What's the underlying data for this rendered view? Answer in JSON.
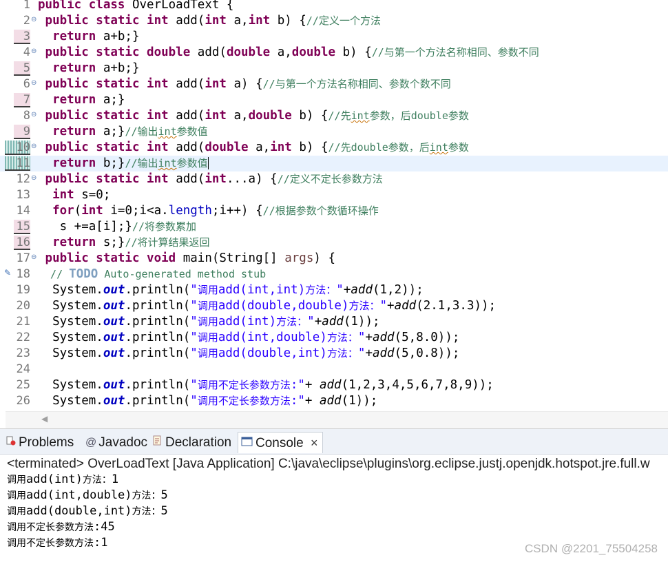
{
  "editor": {
    "lines": [
      {
        "num": "1",
        "segs": [
          [
            "kw",
            "public class "
          ],
          [
            "",
            "OverLoadText {"
          ]
        ]
      },
      {
        "num": "2",
        "segs": [
          [
            "kw",
            " public static int "
          ],
          [
            "",
            "add("
          ],
          [
            "kw",
            "int "
          ],
          [
            "",
            "a,"
          ],
          [
            "kw",
            "int "
          ],
          [
            "",
            "b) {"
          ],
          [
            "cm",
            "//定义一个方法"
          ]
        ]
      },
      {
        "num": "3",
        "segs": [
          [
            "kw",
            "  return "
          ],
          [
            "",
            "a+b;}"
          ]
        ]
      },
      {
        "num": "4",
        "segs": [
          [
            "kw",
            " public static double "
          ],
          [
            "",
            "add("
          ],
          [
            "kw",
            "double "
          ],
          [
            "",
            "a,"
          ],
          [
            "kw",
            "double "
          ],
          [
            "",
            "b) {"
          ],
          [
            "cm",
            "//与第一个方法名称相同、参数不同"
          ]
        ]
      },
      {
        "num": "5",
        "segs": [
          [
            "kw",
            "  return "
          ],
          [
            "",
            "a+b;}"
          ]
        ]
      },
      {
        "num": "6",
        "segs": [
          [
            "kw",
            " public static int "
          ],
          [
            "",
            "add("
          ],
          [
            "kw",
            "int "
          ],
          [
            "",
            "a) {"
          ],
          [
            "cm",
            "//与第一个方法名称相同、参数个数不同"
          ]
        ]
      },
      {
        "num": "7",
        "segs": [
          [
            "kw",
            "  return "
          ],
          [
            "",
            "a;}"
          ]
        ]
      },
      {
        "num": "8",
        "segs": [
          [
            "kw",
            " public static int "
          ],
          [
            "",
            "add("
          ],
          [
            "kw",
            "int "
          ],
          [
            "",
            "a,"
          ],
          [
            "kw",
            "double "
          ],
          [
            "",
            "b) {"
          ],
          [
            "cm",
            "//先"
          ],
          [
            "cm squig",
            "int"
          ],
          [
            "cm",
            "参数，后double参数"
          ]
        ]
      },
      {
        "num": "9",
        "segs": [
          [
            "kw",
            "  return "
          ],
          [
            "",
            "a;}"
          ],
          [
            "cm",
            "//输出"
          ],
          [
            "cm squig",
            "int"
          ],
          [
            "cm",
            "参数值"
          ]
        ]
      },
      {
        "num": "10",
        "segs": [
          [
            "kw",
            " public static int "
          ],
          [
            "",
            "add("
          ],
          [
            "kw",
            "double "
          ],
          [
            "",
            "a,"
          ],
          [
            "kw",
            "int "
          ],
          [
            "",
            "b) {"
          ],
          [
            "cm",
            "//先double参数，后"
          ],
          [
            "cm squig",
            "int"
          ],
          [
            "cm",
            "参数"
          ]
        ]
      },
      {
        "num": "11",
        "segs": [
          [
            "kw",
            "  return "
          ],
          [
            "",
            "b;}"
          ],
          [
            "cm",
            "//输出"
          ],
          [
            "cm squig",
            "int"
          ],
          [
            "cm",
            "参数值"
          ]
        ]
      },
      {
        "num": "12",
        "segs": [
          [
            "kw",
            " public static int "
          ],
          [
            "",
            "add("
          ],
          [
            "kw",
            "int"
          ],
          [
            "",
            "...a) {"
          ],
          [
            "cm",
            "//定义不定长参数方法"
          ]
        ]
      },
      {
        "num": "13",
        "segs": [
          [
            "kw",
            "  int "
          ],
          [
            "",
            "s=0;"
          ]
        ]
      },
      {
        "num": "14",
        "segs": [
          [
            "kw",
            "  for"
          ],
          [
            "",
            "("
          ],
          [
            "kw",
            "int "
          ],
          [
            "",
            "i=0;i<a."
          ],
          [
            "fd",
            "length"
          ],
          [
            "",
            ";i++) {"
          ],
          [
            "cm",
            "//根据参数个数循环操作"
          ]
        ]
      },
      {
        "num": "15",
        "segs": [
          [
            "",
            "   s +=a[i];}"
          ],
          [
            "cm",
            "//将参数累加"
          ]
        ]
      },
      {
        "num": "16",
        "segs": [
          [
            "kw",
            "  return "
          ],
          [
            "",
            "s;}"
          ],
          [
            "cm",
            "//将计算结果返回"
          ]
        ]
      },
      {
        "num": "17",
        "segs": [
          [
            "kw",
            " public static void "
          ],
          [
            "",
            "main(String[] "
          ],
          [
            "param",
            "args"
          ],
          [
            "",
            ") {"
          ]
        ]
      },
      {
        "num": "18",
        "segs": [
          [
            "cm",
            "  // "
          ],
          [
            "cmk",
            "TODO"
          ],
          [
            "cm",
            " Auto-generated method stub"
          ]
        ]
      },
      {
        "num": "19",
        "segs": [
          [
            "",
            "  System."
          ],
          [
            "fl",
            "out"
          ],
          [
            "",
            ".println("
          ],
          [
            "st",
            "\"调用add(int,int)方法：\""
          ],
          [
            "",
            "+"
          ],
          [
            "sm",
            "add"
          ],
          [
            "",
            "(1,2));"
          ]
        ]
      },
      {
        "num": "20",
        "segs": [
          [
            "",
            "  System."
          ],
          [
            "fl",
            "out"
          ],
          [
            "",
            ".println("
          ],
          [
            "st",
            "\"调用add(double,double)方法：\""
          ],
          [
            "",
            "+"
          ],
          [
            "sm",
            "add"
          ],
          [
            "",
            "(2.1,3.3));"
          ]
        ]
      },
      {
        "num": "21",
        "segs": [
          [
            "",
            "  System."
          ],
          [
            "fl",
            "out"
          ],
          [
            "",
            ".println("
          ],
          [
            "st",
            "\"调用add(int)方法：\""
          ],
          [
            "",
            "+"
          ],
          [
            "sm",
            "add"
          ],
          [
            "",
            "(1));"
          ]
        ]
      },
      {
        "num": "22",
        "segs": [
          [
            "",
            "  System."
          ],
          [
            "fl",
            "out"
          ],
          [
            "",
            ".println("
          ],
          [
            "st",
            "\"调用add(int,double)方法：\""
          ],
          [
            "",
            "+"
          ],
          [
            "sm",
            "add"
          ],
          [
            "",
            "(5,8.0));"
          ]
        ]
      },
      {
        "num": "23",
        "segs": [
          [
            "",
            "  System."
          ],
          [
            "fl",
            "out"
          ],
          [
            "",
            ".println("
          ],
          [
            "st",
            "\"调用add(double,int)方法：\""
          ],
          [
            "",
            "+"
          ],
          [
            "sm",
            "add"
          ],
          [
            "",
            "(5,0.8));"
          ]
        ]
      },
      {
        "num": "24",
        "segs": []
      },
      {
        "num": "25",
        "segs": [
          [
            "",
            "  System."
          ],
          [
            "fl",
            "out"
          ],
          [
            "",
            ".println("
          ],
          [
            "st",
            "\"调用不定长参数方法:\""
          ],
          [
            "",
            "+ "
          ],
          [
            "sm",
            "add"
          ],
          [
            "",
            "(1,2,3,4,5,6,7,8,9));"
          ]
        ]
      },
      {
        "num": "26",
        "segs": [
          [
            "",
            "  System."
          ],
          [
            "fl",
            "out"
          ],
          [
            "",
            ".println("
          ],
          [
            "st",
            "\"调用不定长参数方法:\""
          ],
          [
            "",
            "+ "
          ],
          [
            "sm",
            "add"
          ],
          [
            "",
            "(1));"
          ]
        ]
      }
    ],
    "marked_lines": [
      "3",
      "5",
      "7",
      "9",
      "15",
      "16"
    ],
    "changed_lines": [
      "10",
      "11"
    ],
    "fold_lines": [
      "2",
      "4",
      "6",
      "8",
      "10",
      "12",
      "17"
    ],
    "current_line": "11"
  },
  "panel": {
    "tabs": [
      {
        "label": "Problems",
        "icon": "problems-icon"
      },
      {
        "label": "Javadoc",
        "icon": "javadoc-icon"
      },
      {
        "label": "Declaration",
        "icon": "declaration-icon"
      },
      {
        "label": "Console",
        "icon": "console-icon",
        "active": true
      }
    ],
    "close_glyph": "×",
    "status": "<terminated> OverLoadText [Java Application] C:\\java\\eclipse\\plugins\\org.eclipse.justj.openjdk.hotspot.jre.full.w",
    "output": [
      "调用add(int)方法：1",
      "调用add(int,double)方法：5",
      "调用add(double,int)方法：5",
      "调用不定长参数方法:45",
      "调用不定长参数方法:1"
    ]
  },
  "watermark": "CSDN @2201_75504258",
  "colors": {
    "keyword": "#7f0055",
    "comment": "#3f7f5f",
    "string": "#2a00ff",
    "field": "#0000c0",
    "current_line": "#e8f2fe"
  }
}
